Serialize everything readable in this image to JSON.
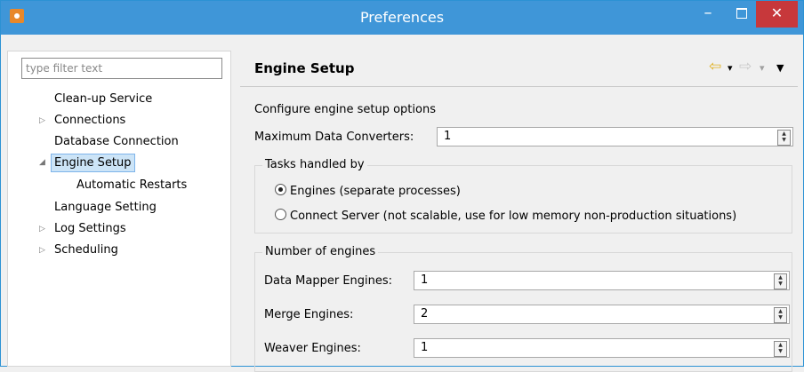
{
  "window": {
    "title": "Preferences",
    "close_glyph": "✕",
    "min_glyph": "–"
  },
  "left": {
    "filter_placeholder": "type filter text",
    "items": [
      {
        "label": "Clean-up Service"
      },
      {
        "label": "Connections"
      },
      {
        "label": "Database Connection"
      },
      {
        "label": "Engine Setup"
      },
      {
        "label": "Automatic Restarts"
      },
      {
        "label": "Language Setting"
      },
      {
        "label": "Log Settings"
      },
      {
        "label": "Scheduling"
      }
    ],
    "twisty_collapsed": "▷",
    "twisty_expanded": "◢",
    "selected_label": "Engine Setup"
  },
  "page": {
    "title": "Engine Setup",
    "back_glyph": "⇦",
    "forward_glyph": "⇨",
    "dropdown_glyph": "▾",
    "menu_glyph": "▼",
    "description": "Configure engine setup options",
    "max_converters_label": "Maximum Data Converters:",
    "max_converters_value": "1",
    "tasks_group": {
      "legend": "Tasks handled by",
      "options": [
        {
          "label": "Engines (separate processes)",
          "selected": true
        },
        {
          "label": "Connect Server (not scalable, use for low memory non-production situations)",
          "selected": false
        }
      ]
    },
    "engines_group": {
      "legend": "Number of engines",
      "fields": [
        {
          "label": "Data Mapper Engines:",
          "value": "1"
        },
        {
          "label": "Merge Engines:",
          "value": "2"
        },
        {
          "label": "Weaver Engines:",
          "value": "1"
        }
      ]
    }
  },
  "colors": {
    "titlebar": "#3f96d8",
    "close": "#c7383b",
    "selection": "#cce4f7",
    "nav_arrow": "#e0b020"
  }
}
